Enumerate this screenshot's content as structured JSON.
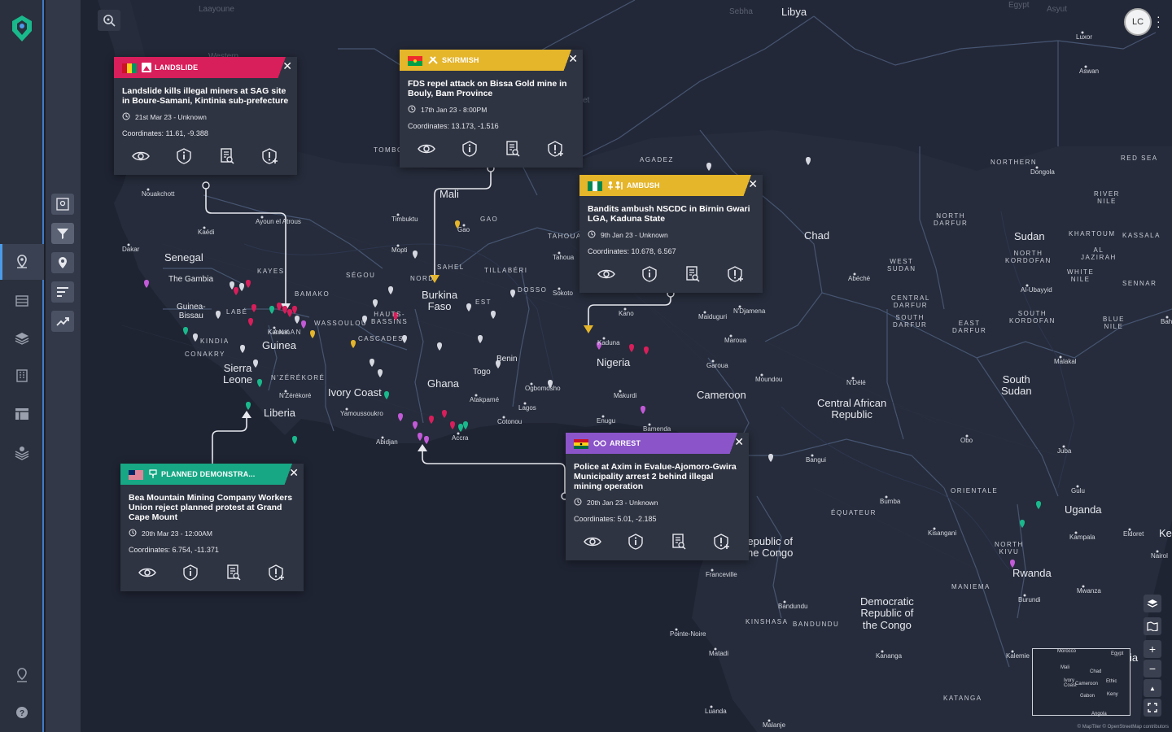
{
  "user": {
    "initials": "LC"
  },
  "map": {
    "countries": [
      {
        "name": "Libya",
        "k": "libya"
      },
      {
        "name": "Mali",
        "k": "mali"
      },
      {
        "name": "Senegal",
        "k": "senegal"
      },
      {
        "name": "The Gambia",
        "k": "gambia"
      },
      {
        "name": "Guinea-\nBissau",
        "k": "gbissau"
      },
      {
        "name": "Guinea",
        "k": "guinea"
      },
      {
        "name": "Sierra\nLeone",
        "k": "sierra"
      },
      {
        "name": "Liberia",
        "k": "liberia"
      },
      {
        "name": "Ivory Coast",
        "k": "ivory"
      },
      {
        "name": "Ghana",
        "k": "ghana"
      },
      {
        "name": "Togo",
        "k": "togo"
      },
      {
        "name": "Benin",
        "k": "benin"
      },
      {
        "name": "Burkina\nFaso",
        "k": "burkina"
      },
      {
        "name": "Nigeria",
        "k": "nigeria"
      },
      {
        "name": "Cameroon",
        "k": "cameroon"
      },
      {
        "name": "Chad",
        "k": "chad"
      },
      {
        "name": "Central African\nRepublic",
        "k": "car"
      },
      {
        "name": "Sudan",
        "k": "sudan"
      },
      {
        "name": "South\nSudan",
        "k": "ssudan"
      },
      {
        "name": "Uganda",
        "k": "uganda"
      },
      {
        "name": "Rwanda",
        "k": "rwanda"
      },
      {
        "name": "Democratic\nRepublic of\nthe Congo",
        "k": "drc"
      },
      {
        "name": "epublic of\nne Congo",
        "k": "roc"
      },
      {
        "name": "Ke",
        "k": "kenya"
      },
      {
        "name": "ia",
        "k": "tanz"
      }
    ],
    "cities": [
      {
        "name": "Nouakchott",
        "k": "nouakchott"
      },
      {
        "name": "Dakar",
        "k": "dakar"
      },
      {
        "name": "Kaédi",
        "k": "kaedi"
      },
      {
        "name": "Ayoun el Atrous",
        "k": "ayoun"
      },
      {
        "name": "Timbuktu",
        "k": "timbuktu"
      },
      {
        "name": "Gao",
        "k": "gao"
      },
      {
        "name": "Mopti",
        "k": "mopti"
      },
      {
        "name": "Tahoua",
        "k": "tahoua"
      },
      {
        "name": "Sokoto",
        "k": "sokoto"
      },
      {
        "name": "Kano",
        "k": "kano"
      },
      {
        "name": "Maiduguri",
        "k": "maiduguri"
      },
      {
        "name": "N'Djamena",
        "k": "ndjamena"
      },
      {
        "name": "Abéché",
        "k": "abeche"
      },
      {
        "name": "Kaduna",
        "k": "kaduna"
      },
      {
        "name": "Makurdi",
        "k": "makurdi"
      },
      {
        "name": "Enugu",
        "k": "enugu"
      },
      {
        "name": "Bamenda",
        "k": "bamenda"
      },
      {
        "name": "Garoua",
        "k": "garoua"
      },
      {
        "name": "Maroua",
        "k": "maroua"
      },
      {
        "name": "Moundou",
        "k": "moundou"
      },
      {
        "name": "N'Délé",
        "k": "ndele"
      },
      {
        "name": "Lagos",
        "k": "lagos"
      },
      {
        "name": "Ogbomosho",
        "k": "ogbomosho"
      },
      {
        "name": "Cotonou",
        "k": "cotonou"
      },
      {
        "name": "Atakpamé",
        "k": "atakpame"
      },
      {
        "name": "Accra",
        "k": "accra"
      },
      {
        "name": "Abidjan",
        "k": "abidjan"
      },
      {
        "name": "Yamoussoukro",
        "k": "yamoussoukro"
      },
      {
        "name": "N'Zérékoré",
        "k": "nzerekore"
      },
      {
        "name": "Kankan",
        "k": "kankan"
      },
      {
        "name": "Bangui",
        "k": "bangui"
      },
      {
        "name": "Bumba",
        "k": "bumba"
      },
      {
        "name": "Kisangani",
        "k": "kisangani"
      },
      {
        "name": "Obo",
        "k": "obo"
      },
      {
        "name": "Juba",
        "k": "juba"
      },
      {
        "name": "Gulu",
        "k": "gulu"
      },
      {
        "name": "Kampala",
        "k": "kampala"
      },
      {
        "name": "Eldoret",
        "k": "eldoret"
      },
      {
        "name": "Nairol",
        "k": "nairobi"
      },
      {
        "name": "Mwanza",
        "k": "mwanza"
      },
      {
        "name": "Burundi",
        "k": "burundi"
      },
      {
        "name": "Kalemie",
        "k": "kalemie"
      },
      {
        "name": "Kananga",
        "k": "kananga"
      },
      {
        "name": "Bandundu",
        "k": "bandundu"
      },
      {
        "name": "Franceville",
        "k": "franceville"
      },
      {
        "name": "Pointe-Noire",
        "k": "pointe"
      },
      {
        "name": "Matadi",
        "k": "matadi"
      },
      {
        "name": "Luanda",
        "k": "luanda"
      },
      {
        "name": "Malanje",
        "k": "malanje"
      },
      {
        "name": "Malakal",
        "k": "malakal"
      },
      {
        "name": "Al-Ubayyid",
        "k": "alubayyid"
      },
      {
        "name": "Dongola",
        "k": "dongola"
      },
      {
        "name": "Aswan",
        "k": "aswan"
      },
      {
        "name": "Luxor",
        "k": "luxor"
      },
      {
        "name": "Bah",
        "k": "bah"
      }
    ],
    "regions": [
      {
        "name": "TOMBO",
        "k": "tombo"
      },
      {
        "name": "KAYES",
        "k": "kayes"
      },
      {
        "name": "SÉGOU",
        "k": "segou"
      },
      {
        "name": "BAMAKO",
        "k": "bamako"
      },
      {
        "name": "KANKAN",
        "k": "kankanr"
      },
      {
        "name": "LABÉ",
        "k": "labe"
      },
      {
        "name": "KINDIA",
        "k": "kindia"
      },
      {
        "name": "CONAKRY",
        "k": "conakry"
      },
      {
        "name": "WASSOULOU",
        "k": "wassoulou"
      },
      {
        "name": "HAUTS-\nBASSINS",
        "k": "hauts"
      },
      {
        "name": "CASCADES",
        "k": "cascades"
      },
      {
        "name": "N'ZÉRÉKORÉ",
        "k": "nzerekorer"
      },
      {
        "name": "NORD",
        "k": "nord"
      },
      {
        "name": "SAHEL",
        "k": "sahel"
      },
      {
        "name": "EST",
        "k": "est"
      },
      {
        "name": "TILLABÉRI",
        "k": "tillaberi"
      },
      {
        "name": "DOSSO",
        "k": "dosso"
      },
      {
        "name": "TAHOUA",
        "k": "tahouar"
      },
      {
        "name": "GAO",
        "k": "gaor"
      },
      {
        "name": "AGADEZ",
        "k": "agadez"
      },
      {
        "name": "NORTHERN",
        "k": "northern"
      },
      {
        "name": "RED SEA",
        "k": "redsea"
      },
      {
        "name": "RIVER\nNILE",
        "k": "rivernile"
      },
      {
        "name": "NORTH\nDARFUR",
        "k": "ndarfur"
      },
      {
        "name": "KHARTOUM",
        "k": "khartoum"
      },
      {
        "name": "KASSALA",
        "k": "kassala"
      },
      {
        "name": "NORTH\nKORDOFAN",
        "k": "nkordofan"
      },
      {
        "name": "AL\nJAZIRAH",
        "k": "aljazirah"
      },
      {
        "name": "WHITE\nNILE",
        "k": "whitenile"
      },
      {
        "name": "SENNAR",
        "k": "sennar"
      },
      {
        "name": "WEST\nSUDAN",
        "k": "wsudan"
      },
      {
        "name": "CENTRAL\nDARFUR",
        "k": "cdarfur"
      },
      {
        "name": "SOUTH\nDARFUR",
        "k": "sdarfur"
      },
      {
        "name": "EAST\nDARFUR",
        "k": "edarfur"
      },
      {
        "name": "SOUTH\nKORDOFAN",
        "k": "skordofan"
      },
      {
        "name": "BLUE\nNILE",
        "k": "bluenile"
      },
      {
        "name": "ORIENTALE",
        "k": "orientale"
      },
      {
        "name": "ÉQUATEUR",
        "k": "equateur"
      },
      {
        "name": "NORTH\nKIVU",
        "k": "nkivu"
      },
      {
        "name": "MANIEMA",
        "k": "maniema"
      },
      {
        "name": "KINSHASA",
        "k": "kinshasa"
      },
      {
        "name": "BANDUNDU",
        "k": "bandundur"
      },
      {
        "name": "KATANGA",
        "k": "katanga"
      }
    ],
    "faint": [
      {
        "name": "Laayoune",
        "k": "laayoune"
      },
      {
        "name": "Sebha",
        "k": "sebha"
      },
      {
        "name": "Egypt",
        "k": "egypt"
      },
      {
        "name": "Asyut",
        "k": "asyut"
      },
      {
        "name": "Western",
        "k": "western"
      },
      {
        "name": "et",
        "k": "et"
      }
    ],
    "zoom_in": "+",
    "zoom_out": "−",
    "north": "▲",
    "attribution": "© MapTiler © OpenStreetMap contributors"
  },
  "minimap": {
    "labels": [
      {
        "name": "Morocco",
        "k": "mm-morocco"
      },
      {
        "name": "Egypt",
        "k": "mm-egypt"
      },
      {
        "name": "Mali",
        "k": "mm-mali"
      },
      {
        "name": "Chad",
        "k": "mm-chad"
      },
      {
        "name": "Ivory\nCoast",
        "k": "mm-ivory"
      },
      {
        "name": "Cameroon",
        "k": "mm-cameroon"
      },
      {
        "name": "Ethic",
        "k": "mm-ethiopia"
      },
      {
        "name": "Gabon",
        "k": "mm-gabon"
      },
      {
        "name": "Keny",
        "k": "mm-kenya"
      },
      {
        "name": "Angola",
        "k": "mm-angola"
      }
    ]
  },
  "events": [
    {
      "k": "landslide",
      "category": "LANDSLIDE",
      "color": "#d81e5b",
      "title": "Landslide kills illegal miners at SAG site in Boure-Samani, Kintinia sub-prefecture",
      "time": "21st Mar 23 - Unknown",
      "coordinates": "Coordinates: 11.61, -9.388"
    },
    {
      "k": "skirmish",
      "category": "SKIRMISH",
      "color": "#e5b52a",
      "title": "FDS repel attack on Bissa Gold mine in Bouly, Bam Province",
      "time": "17th Jan 23 - 8:00PM",
      "coordinates": "Coordinates: 13.173, -1.516"
    },
    {
      "k": "ambush",
      "category": "AMBUSH",
      "color": "#e5b52a",
      "title": "Bandits ambush NSCDC in Birnin Gwari LGA, Kaduna State",
      "time": "9th Jan 23 - Unknown",
      "coordinates": "Coordinates: 10.678, 6.567"
    },
    {
      "k": "arrest",
      "category": "ARREST",
      "color": "#8b55c9",
      "title": "Police at Axim in Evalue-Ajomoro-Gwira Municipality arrest 2 behind illegal mining operation",
      "time": "20th Jan 23 - Unknown",
      "coordinates": "Coordinates: 5.01, -2.185"
    },
    {
      "k": "protest",
      "category": "PLANNED DEMONSTRA...",
      "color": "#17a784",
      "title": "Bea Mountain Mining Company Workers Union reject planned protest at Grand Cape Mount",
      "time": "20th Mar 23 - 12:00AM",
      "coordinates": "Coordinates: 6.754, -11.371"
    }
  ],
  "icons": {
    "view": "eye-icon",
    "info": "info-icon",
    "report": "report-icon",
    "alert": "add-alert-icon",
    "close": "close-icon",
    "clock": "clock-icon"
  }
}
